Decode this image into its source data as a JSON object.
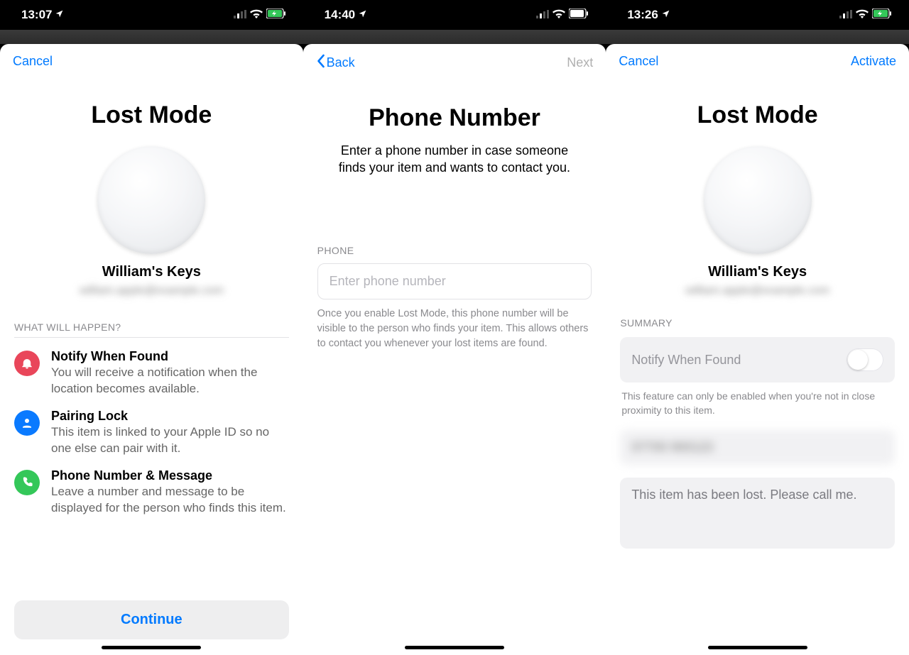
{
  "screen1": {
    "status": {
      "time": "13:07",
      "battery_charging": true
    },
    "nav": {
      "left": "Cancel"
    },
    "title": "Lost Mode",
    "item_name": "William's Keys",
    "section_label": "WHAT WILL HAPPEN?",
    "bullets": [
      {
        "title": "Notify When Found",
        "desc": "You will receive a notification when the location becomes available."
      },
      {
        "title": "Pairing Lock",
        "desc": "This item is linked to your Apple ID so no one else can pair with it."
      },
      {
        "title": "Phone Number & Message",
        "desc": "Leave a number and message to be displayed for the person who finds this item."
      }
    ],
    "continue": "Continue"
  },
  "screen2": {
    "status": {
      "time": "14:40",
      "battery_charging": false
    },
    "nav": {
      "back": "Back",
      "next": "Next"
    },
    "title": "Phone Number",
    "subtitle": "Enter a phone number in case someone finds your item and wants to contact you.",
    "form_label": "PHONE",
    "placeholder": "Enter phone number",
    "footnote": "Once you enable Lost Mode, this phone number will be visible to the person who finds your item. This allows others to contact you whenever your lost items are found."
  },
  "screen3": {
    "status": {
      "time": "13:26",
      "battery_charging": true
    },
    "nav": {
      "left": "Cancel",
      "right": "Activate"
    },
    "title": "Lost Mode",
    "item_name": "William's Keys",
    "summary_label": "SUMMARY",
    "notify_label": "Notify When Found",
    "notify_note": "This feature can only be enabled when you're not in close proximity to this item.",
    "message": "This item has been lost. Please call me."
  }
}
